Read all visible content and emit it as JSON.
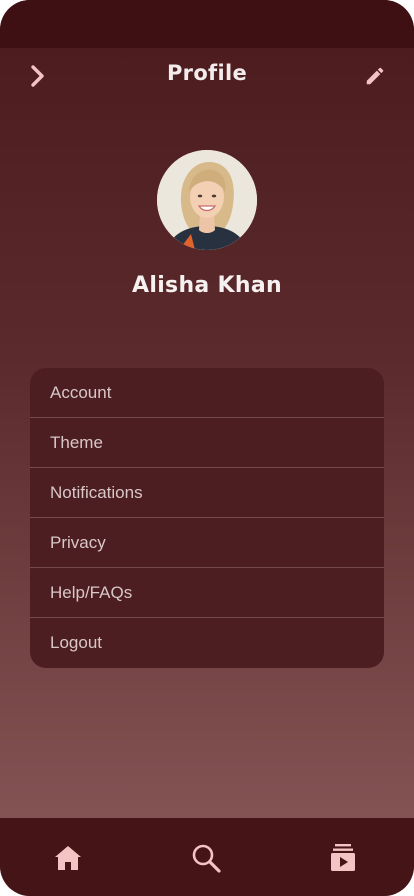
{
  "header": {
    "title": "Profile"
  },
  "profile": {
    "name": "Alisha Khan"
  },
  "menu": {
    "items": [
      {
        "label": "Account"
      },
      {
        "label": "Theme"
      },
      {
        "label": "Notifications"
      },
      {
        "label": "Privacy"
      },
      {
        "label": "Help/FAQs"
      },
      {
        "label": "Logout"
      }
    ]
  },
  "nav": {
    "icons": [
      "home-icon",
      "search-icon",
      "library-play-icon"
    ]
  },
  "colors": {
    "background_top": "#4a1a1c",
    "background_bottom": "#8a5a5b",
    "menu_card": "#4d1e21",
    "nav_bar": "#451416",
    "icon_tint": "#f2c4c4"
  }
}
